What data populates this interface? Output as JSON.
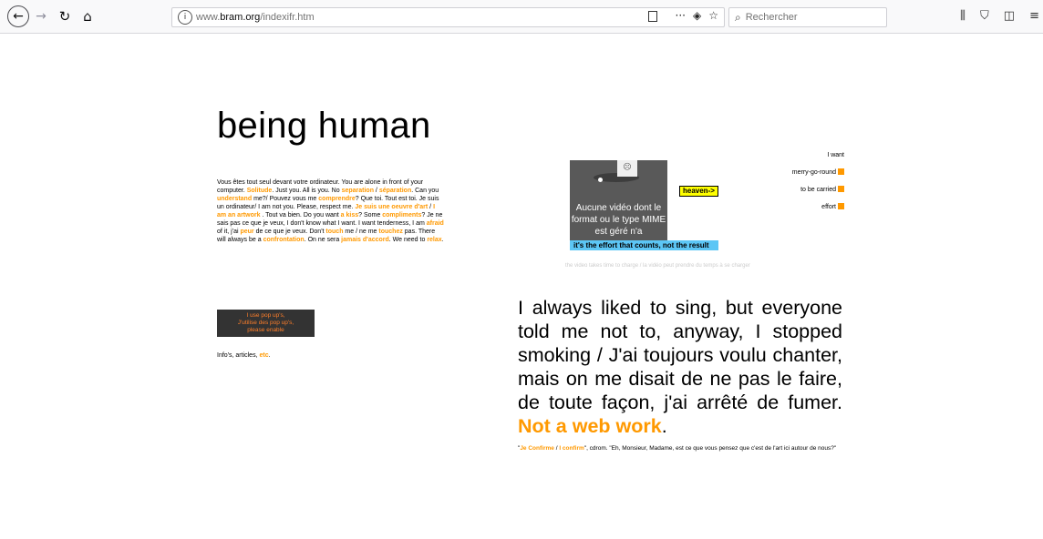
{
  "browser": {
    "url_host": "www.",
    "url_domain": "bram.org",
    "url_path": "/indexifr.htm",
    "url_info_glyph": "i",
    "menu_dots": "···",
    "search_placeholder": "Rechercher"
  },
  "page": {
    "title": "being human",
    "intro": [
      {
        "t": "Vous êtes tout seul devant votre ordinateur. You are alone in front of your computer. "
      },
      {
        "t": "Solitude",
        "o": true
      },
      {
        "t": ". Just you. All is you. No "
      },
      {
        "t": "separation",
        "o": true
      },
      {
        "t": " / "
      },
      {
        "t": "séparation",
        "o": true
      },
      {
        "t": ". Can you "
      },
      {
        "t": "understand",
        "o": true
      },
      {
        "t": " me?/ Pouvez vous me "
      },
      {
        "t": "comprendre",
        "o": true
      },
      {
        "t": "? Que toi. Tout est toi. Je suis un ordinateur/ I am not you. Please, respect me. "
      },
      {
        "t": "Je suis une oeuvre d'art",
        "o": true
      },
      {
        "t": " / "
      },
      {
        "t": "I am an artwork",
        "o": true
      },
      {
        "t": " . Tout va bien. Do you want "
      },
      {
        "t": "a kiss",
        "o": true
      },
      {
        "t": "? Some "
      },
      {
        "t": "compliments",
        "o": true
      },
      {
        "t": "? Je ne sais pas ce que je veux, I don't know  what I want. I want tenderness, I am "
      },
      {
        "t": "afraid",
        "o": true
      },
      {
        "t": " of it, j'ai "
      },
      {
        "t": "peur",
        "o": true
      },
      {
        "t": " de ce que je veux. Don't "
      },
      {
        "t": "touch",
        "o": true
      },
      {
        "t": " me / ne me "
      },
      {
        "t": "touchez",
        "o": true
      },
      {
        "t": " pas. There will always be a "
      },
      {
        "t": "confrontation",
        "o": true
      },
      {
        "t": ". On ne sera "
      },
      {
        "t": "jamais d'accord",
        "o": true
      },
      {
        "t": ". We need to "
      },
      {
        "t": "relax",
        "o": true
      },
      {
        "t": "."
      }
    ],
    "popup_lines": [
      "I use pop up's,",
      "J'utilise des pop up's,",
      "please enable"
    ],
    "info_text": "Info's, articles, ",
    "info_link": "etc",
    "info_end": ".",
    "video_message": "Aucune vidéo dont le format ou le type MIME est géré n'a",
    "heaven_label": "heaven->",
    "effort_label": "it's the effort that counts, not the result",
    "video_note": "the video takes time to charge / la vidéo peut prendre du temps à se charger",
    "want_items": [
      {
        "label": "I want",
        "square": false
      },
      {
        "label": "merry-go-round",
        "square": true
      },
      {
        "label": "to be carried",
        "square": true
      },
      {
        "label": "effort",
        "square": true
      }
    ],
    "quote": "I always liked to sing, but everyone told me not to, anyway, I stopped smoking / J'ai toujours voulu chanter, mais on me disait de ne pas le faire, de toute façon, j'ai arrêté de fumer. ",
    "quote_highlight": "Not a web work",
    "quote_end": ".",
    "confirm_q1": "\"",
    "confirm_link1": "Je Confirme",
    "confirm_sep": " / ",
    "confirm_link2": "I confirm",
    "confirm_rest": "\", cdrom. \"Eh, Monsieur, Madame, est ce que vous pensez que c'est de l'art ici autour de nous?\""
  },
  "colors": {
    "accent": "#ff9900",
    "highlight_yellow": "#ffff00",
    "effort_blue": "#5cc6f5",
    "popup_bg": "#333333"
  }
}
